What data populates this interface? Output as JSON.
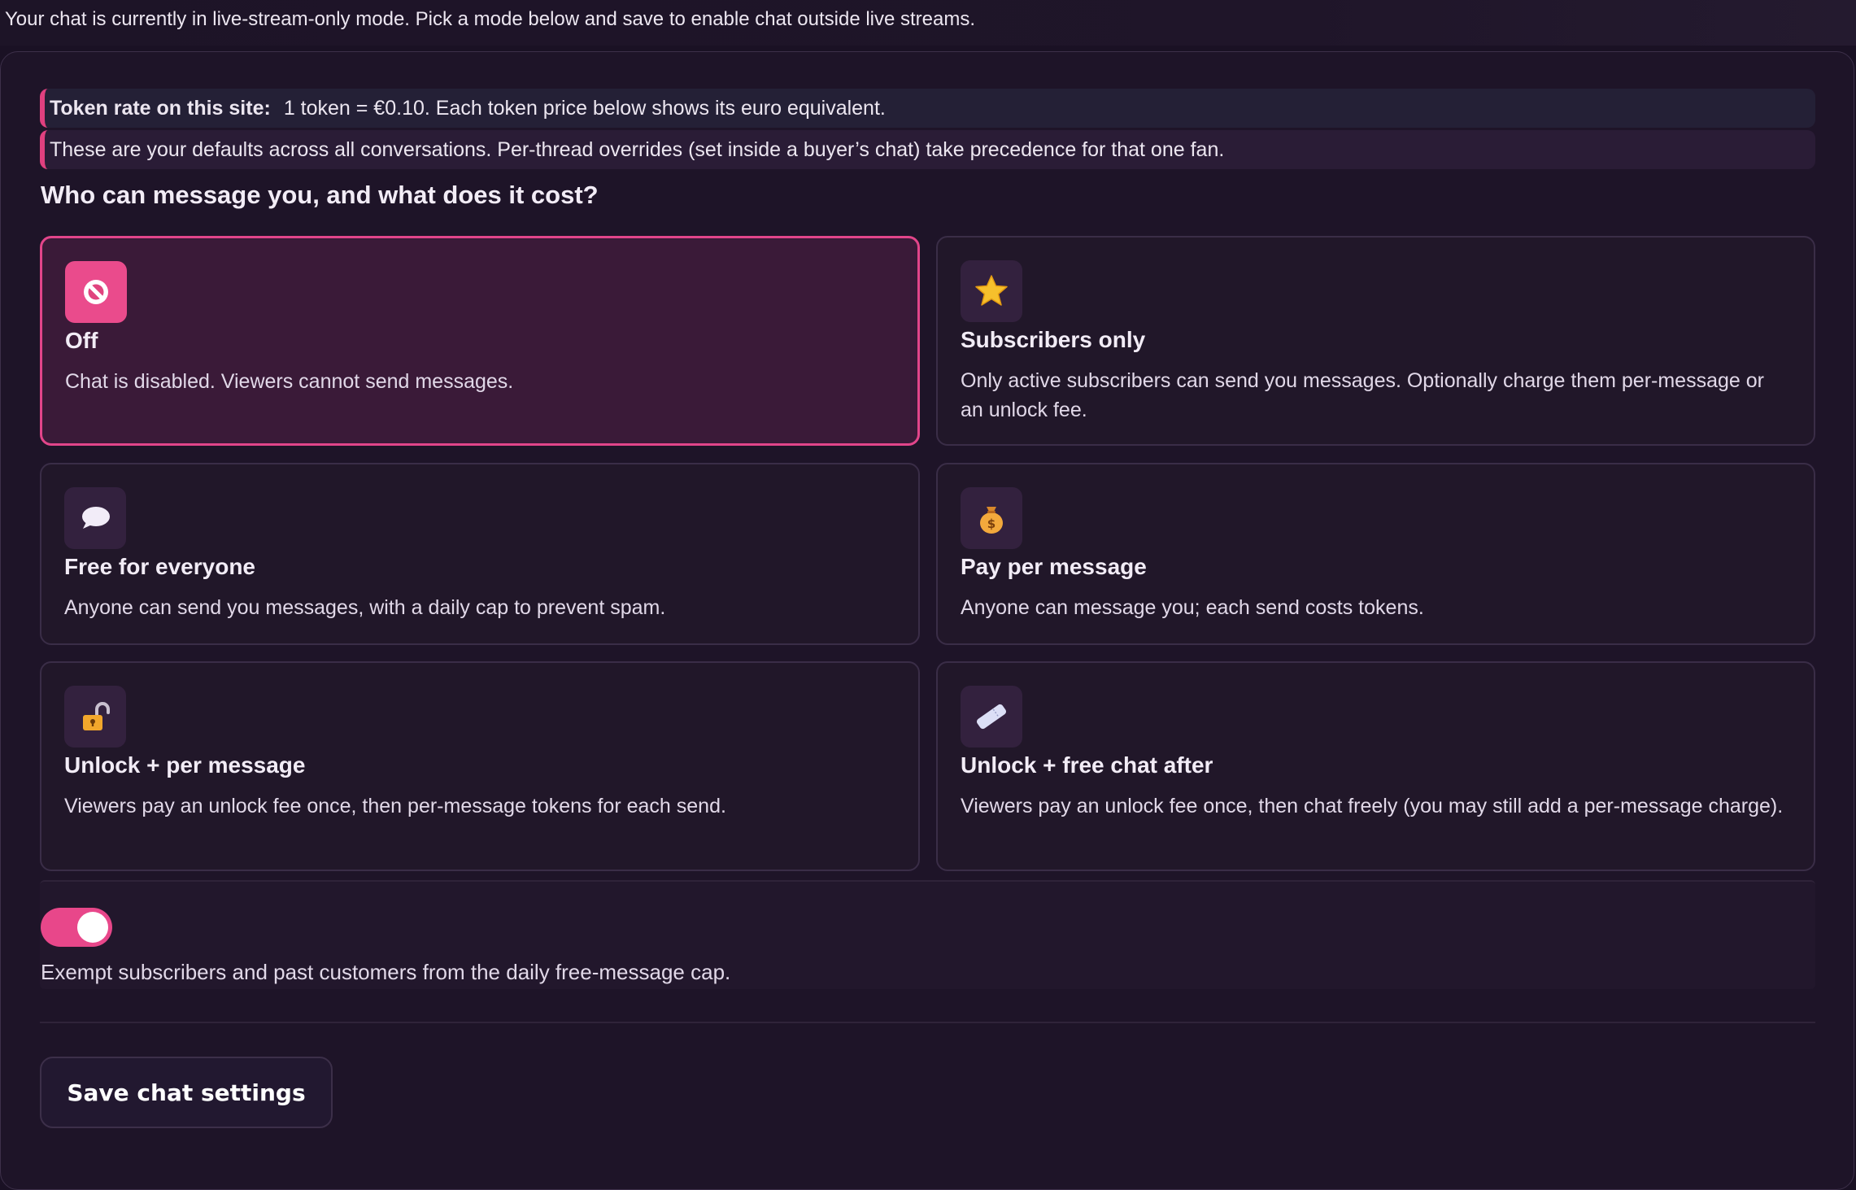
{
  "banner": {
    "text": "Your chat is currently in live-stream-only mode. Pick a mode below and save to enable chat outside live streams."
  },
  "notes": {
    "rate_label": "Token rate on this site:",
    "rate_text": "1 token = €0.10. Each token price below shows its euro equivalent.",
    "defaults_text": "These are your defaults across all conversations. Per-thread overrides (set inside a buyer’s chat) take precedence for that one fan."
  },
  "section": {
    "heading": "Who can message you, and what does it cost?"
  },
  "modes": [
    {
      "title": "Off",
      "description": "Chat is disabled. Viewers cannot send messages.",
      "icon": "no-entry-icon",
      "selected": true
    },
    {
      "title": "Subscribers only",
      "description": "Only active subscribers can send you messages. Optionally charge them per-message or an unlock fee.",
      "icon": "star-icon",
      "selected": false
    },
    {
      "title": "Free for everyone",
      "description": "Anyone can send you messages, with a daily cap to prevent spam.",
      "icon": "speech-bubble-icon",
      "selected": false
    },
    {
      "title": "Pay per message",
      "description": "Anyone can message you; each send costs tokens.",
      "icon": "money-bag-icon",
      "selected": false
    },
    {
      "title": "Unlock + per message",
      "description": "Viewers pay an unlock fee once, then per-message tokens for each send.",
      "icon": "unlocked-padlock-icon",
      "selected": false
    },
    {
      "title": "Unlock + free chat after",
      "description": "Viewers pay an unlock fee once, then chat freely (you may still add a per-message charge).",
      "icon": "ticket-icon",
      "selected": false
    }
  ],
  "exempt": {
    "enabled": true,
    "label": "Exempt subscribers and past customers from the daily free-message cap."
  },
  "actions": {
    "save_label": "Save chat settings"
  },
  "colors": {
    "accent": "#e8478a",
    "background": "#1a1124",
    "card": "#211729",
    "selected_card": "#3a1a38"
  }
}
